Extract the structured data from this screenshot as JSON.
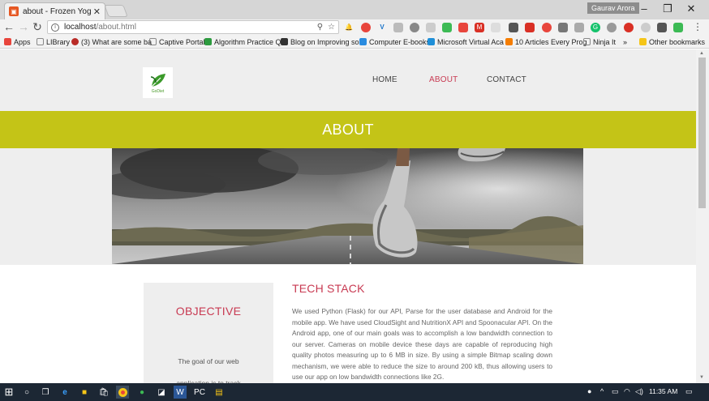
{
  "browser": {
    "tab_title": "about - Frozen Yogurt Sh",
    "profile_name": "Gaurav Arora",
    "url_host": "localhost",
    "url_path": "/about.html"
  },
  "bookmarks": [
    {
      "label": "Apps",
      "color": "#e8453c"
    },
    {
      "label": "LIBrary",
      "color": "#ffffff"
    },
    {
      "label": "(3) What are some ba",
      "color": "#b92b27"
    },
    {
      "label": "Captive Portal",
      "color": "#ffffff"
    },
    {
      "label": "Algorithm Practice Q",
      "color": "#2d9b3f"
    },
    {
      "label": "Blog on Improving so",
      "color": "#333333"
    },
    {
      "label": "Computer E-books",
      "color": "#2a8ce0"
    },
    {
      "label": "Microsoft Virtual Aca",
      "color": "#1f8fd8"
    },
    {
      "label": "10 Articles Every Prog",
      "color": "#f57d00"
    },
    {
      "label": "Ninja It",
      "color": "#ffffff"
    },
    {
      "label": "»",
      "color": ""
    },
    {
      "label": "Other bookmarks",
      "color": "#f5c518"
    }
  ],
  "site": {
    "logo_text": "GoDiet",
    "nav": {
      "home": "HOME",
      "about": "ABOUT",
      "contact": "CONTACT"
    },
    "banner_title": "ABOUT",
    "objective_title": "OBJECTIVE",
    "objective_text_1": "The goal of our web",
    "objective_text_2": "application is to track",
    "techstack_title": "TECH STACK",
    "techstack_text": "We used Python (Flask) for our API, Parse for the user database and Android for the mobile app. We have used CloudSight and NutritionX API and Spoonacular API. On the Android app, one of our main goals was to accomplish a low bandwidth connection to our server. Cameras on mobile device these days are capable of reproducing high quality photos measuring up to 6 MB in size. By using a simple Bitmap scaling down mechanism, we were able to reduce the size to around 200 kB, thus allowing users to use our app on low bandwidth connections like 2G."
  },
  "taskbar": {
    "clock": "11:35 AM"
  },
  "colors": {
    "accent": "#c83a52",
    "banner": "#c4c417",
    "header_bg": "#eeeeee"
  }
}
